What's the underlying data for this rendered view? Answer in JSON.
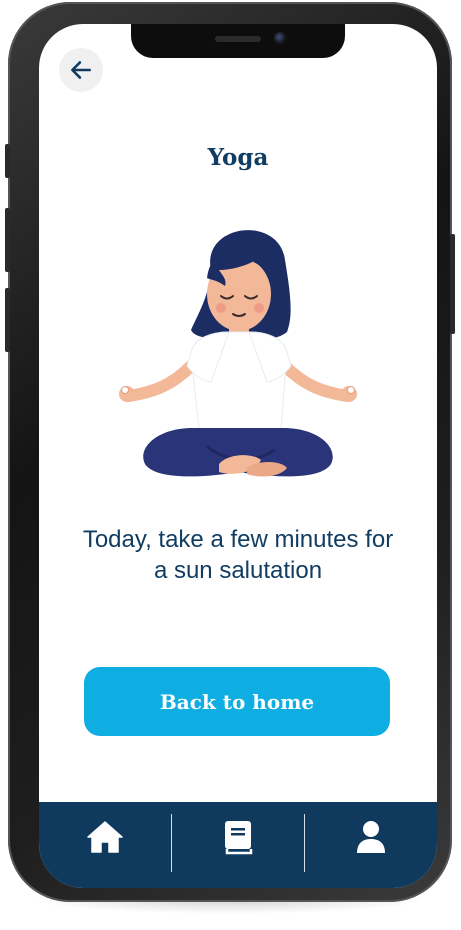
{
  "header": {
    "back_icon": "arrow-left-icon"
  },
  "page": {
    "title": "Yoga",
    "illustration": "woman-meditating-lotus-pose",
    "message": "Today, take a few minutes for a sun salutation"
  },
  "actions": {
    "back_home_label": "Back to home"
  },
  "tabbar": {
    "items": [
      {
        "icon": "home-icon"
      },
      {
        "icon": "book-icon"
      },
      {
        "icon": "user-icon"
      }
    ]
  },
  "colors": {
    "primary_dark": "#0f3a5e",
    "accent": "#0eaee2",
    "text": "#123d63",
    "background": "#ffffff"
  }
}
